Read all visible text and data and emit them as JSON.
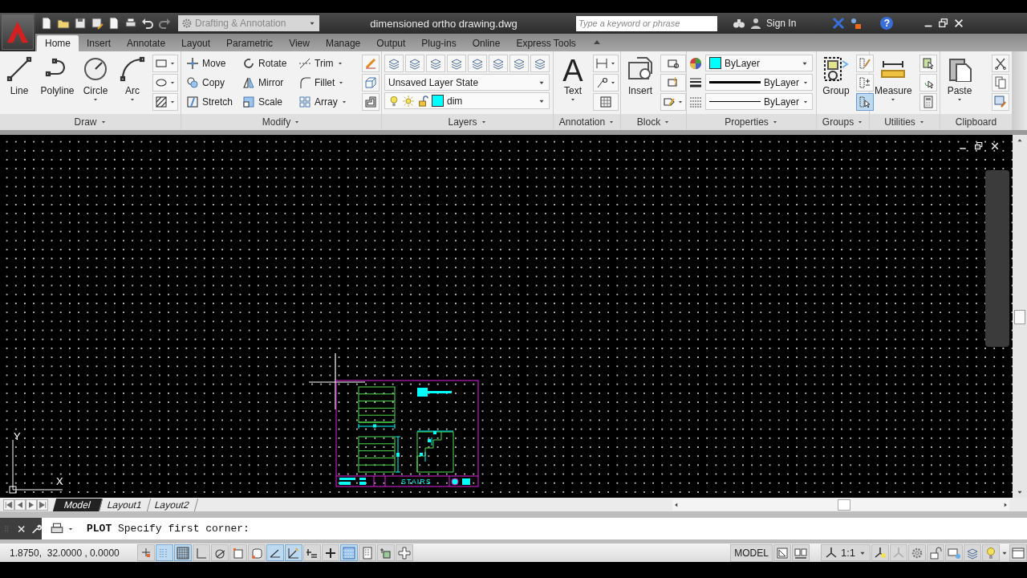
{
  "title_bar": {
    "workspace": "Drafting & Annotation",
    "document_title": "dimensioned ortho drawing.dwg",
    "search": {
      "placeholder": "Type a keyword or phrase"
    },
    "sign_in": "Sign In",
    "help": "?"
  },
  "tabs": [
    {
      "label": "Home",
      "selected": true
    },
    {
      "label": "Insert",
      "selected": false
    },
    {
      "label": "Annotate",
      "selected": false
    },
    {
      "label": "Layout",
      "selected": false
    },
    {
      "label": "Parametric",
      "selected": false
    },
    {
      "label": "View",
      "selected": false
    },
    {
      "label": "Manage",
      "selected": false
    },
    {
      "label": "Output",
      "selected": false
    },
    {
      "label": "Plug-ins",
      "selected": false
    },
    {
      "label": "Online",
      "selected": false
    },
    {
      "label": "Express Tools",
      "selected": false
    }
  ],
  "ribbon": [
    {
      "kind": "tools",
      "title": "Draw",
      "expandable": true,
      "large": [
        {
          "label": "Line",
          "menu": false
        },
        {
          "label": "Polyline",
          "menu": false
        },
        {
          "label": "Circle",
          "menu": true
        },
        {
          "label": "Arc",
          "menu": true
        }
      ]
    },
    {
      "kind": "modify",
      "title": "Modify",
      "expandable": true,
      "rows": [
        [
          {
            "label": "Move",
            "menu": false
          },
          {
            "label": "Rotate",
            "menu": false
          },
          {
            "label": "Trim",
            "menu": true
          }
        ],
        [
          {
            "label": "Copy",
            "menu": false
          },
          {
            "label": "Mirror",
            "menu": false
          },
          {
            "label": "Fillet",
            "menu": true
          }
        ],
        [
          {
            "label": "Stretch",
            "menu": false
          },
          {
            "label": "Scale",
            "menu": false
          },
          {
            "label": "Array",
            "menu": true
          }
        ]
      ]
    },
    {
      "kind": "layers",
      "title": "Layers",
      "expandable": true,
      "layer_state": "Unsaved Layer State",
      "current_layer": {
        "name": "dim",
        "color": "#00ffff"
      }
    },
    {
      "kind": "tools",
      "title": "Annotation",
      "expandable": true,
      "large": [
        {
          "label": "Text",
          "icon_text": "A",
          "menu": true
        }
      ]
    },
    {
      "kind": "tools",
      "title": "Block",
      "expandable": true,
      "large": [
        {
          "label": "Insert",
          "menu": false
        }
      ]
    },
    {
      "kind": "properties",
      "title": "Properties",
      "expandable": true,
      "color": {
        "value": "ByLayer",
        "color": "#00ffff"
      },
      "lineweight": "ByLayer",
      "linetype": "ByLayer"
    },
    {
      "kind": "tools",
      "title": "Groups",
      "expandable": true,
      "large": [
        {
          "label": "Group",
          "menu": false
        }
      ],
      "selection_on": true
    },
    {
      "kind": "tools",
      "title": "Utilities",
      "expandable": true,
      "large": [
        {
          "label": "Measure",
          "menu": true
        }
      ]
    },
    {
      "kind": "tools",
      "title": "Clipboard",
      "expandable": false,
      "large": [
        {
          "label": "Paste",
          "menu": true
        }
      ]
    }
  ],
  "canvas": {
    "ucs": {
      "x_label": "X",
      "y_label": "Y"
    },
    "title_block": "STAIRS"
  },
  "layout_tabs": [
    {
      "kind": "model",
      "label": "Model",
      "selected": true
    },
    {
      "kind": "layout",
      "label": "Layout1",
      "selected": false
    },
    {
      "kind": "layout",
      "label": "Layout2",
      "selected": false
    }
  ],
  "command_line": {
    "prompt": "**PLOT** Specify first corner:"
  },
  "status_bar": {
    "coordinates": "1.8750,  32.0000 , 0.0000",
    "toggles": [
      {
        "on": false
      },
      {
        "on": true
      },
      {
        "on": true
      },
      {
        "on": false
      },
      {
        "on": false
      },
      {
        "on": false
      },
      {
        "on": false
      },
      {
        "on": true
      },
      {
        "on": true
      },
      {
        "on": false
      },
      {
        "on": false
      },
      {
        "on": true
      },
      {
        "on": false
      },
      {
        "on": false
      },
      {
        "on": false
      }
    ],
    "space": "MODEL",
    "annotation_scale": "1:1"
  }
}
